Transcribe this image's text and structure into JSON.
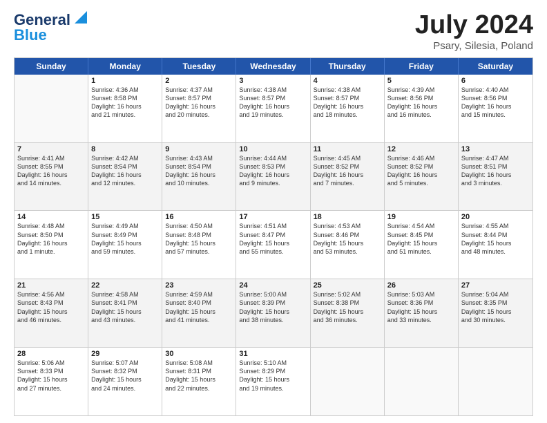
{
  "header": {
    "logo_line1": "General",
    "logo_line2": "Blue",
    "title": "July 2024",
    "subtitle": "Psary, Silesia, Poland"
  },
  "calendar": {
    "days": [
      "Sunday",
      "Monday",
      "Tuesday",
      "Wednesday",
      "Thursday",
      "Friday",
      "Saturday"
    ],
    "rows": [
      [
        {
          "num": "",
          "lines": []
        },
        {
          "num": "1",
          "lines": [
            "Sunrise: 4:36 AM",
            "Sunset: 8:58 PM",
            "Daylight: 16 hours",
            "and 21 minutes."
          ]
        },
        {
          "num": "2",
          "lines": [
            "Sunrise: 4:37 AM",
            "Sunset: 8:57 PM",
            "Daylight: 16 hours",
            "and 20 minutes."
          ]
        },
        {
          "num": "3",
          "lines": [
            "Sunrise: 4:38 AM",
            "Sunset: 8:57 PM",
            "Daylight: 16 hours",
            "and 19 minutes."
          ]
        },
        {
          "num": "4",
          "lines": [
            "Sunrise: 4:38 AM",
            "Sunset: 8:57 PM",
            "Daylight: 16 hours",
            "and 18 minutes."
          ]
        },
        {
          "num": "5",
          "lines": [
            "Sunrise: 4:39 AM",
            "Sunset: 8:56 PM",
            "Daylight: 16 hours",
            "and 16 minutes."
          ]
        },
        {
          "num": "6",
          "lines": [
            "Sunrise: 4:40 AM",
            "Sunset: 8:56 PM",
            "Daylight: 16 hours",
            "and 15 minutes."
          ]
        }
      ],
      [
        {
          "num": "7",
          "lines": [
            "Sunrise: 4:41 AM",
            "Sunset: 8:55 PM",
            "Daylight: 16 hours",
            "and 14 minutes."
          ]
        },
        {
          "num": "8",
          "lines": [
            "Sunrise: 4:42 AM",
            "Sunset: 8:54 PM",
            "Daylight: 16 hours",
            "and 12 minutes."
          ]
        },
        {
          "num": "9",
          "lines": [
            "Sunrise: 4:43 AM",
            "Sunset: 8:54 PM",
            "Daylight: 16 hours",
            "and 10 minutes."
          ]
        },
        {
          "num": "10",
          "lines": [
            "Sunrise: 4:44 AM",
            "Sunset: 8:53 PM",
            "Daylight: 16 hours",
            "and 9 minutes."
          ]
        },
        {
          "num": "11",
          "lines": [
            "Sunrise: 4:45 AM",
            "Sunset: 8:52 PM",
            "Daylight: 16 hours",
            "and 7 minutes."
          ]
        },
        {
          "num": "12",
          "lines": [
            "Sunrise: 4:46 AM",
            "Sunset: 8:52 PM",
            "Daylight: 16 hours",
            "and 5 minutes."
          ]
        },
        {
          "num": "13",
          "lines": [
            "Sunrise: 4:47 AM",
            "Sunset: 8:51 PM",
            "Daylight: 16 hours",
            "and 3 minutes."
          ]
        }
      ],
      [
        {
          "num": "14",
          "lines": [
            "Sunrise: 4:48 AM",
            "Sunset: 8:50 PM",
            "Daylight: 16 hours",
            "and 1 minute."
          ]
        },
        {
          "num": "15",
          "lines": [
            "Sunrise: 4:49 AM",
            "Sunset: 8:49 PM",
            "Daylight: 15 hours",
            "and 59 minutes."
          ]
        },
        {
          "num": "16",
          "lines": [
            "Sunrise: 4:50 AM",
            "Sunset: 8:48 PM",
            "Daylight: 15 hours",
            "and 57 minutes."
          ]
        },
        {
          "num": "17",
          "lines": [
            "Sunrise: 4:51 AM",
            "Sunset: 8:47 PM",
            "Daylight: 15 hours",
            "and 55 minutes."
          ]
        },
        {
          "num": "18",
          "lines": [
            "Sunrise: 4:53 AM",
            "Sunset: 8:46 PM",
            "Daylight: 15 hours",
            "and 53 minutes."
          ]
        },
        {
          "num": "19",
          "lines": [
            "Sunrise: 4:54 AM",
            "Sunset: 8:45 PM",
            "Daylight: 15 hours",
            "and 51 minutes."
          ]
        },
        {
          "num": "20",
          "lines": [
            "Sunrise: 4:55 AM",
            "Sunset: 8:44 PM",
            "Daylight: 15 hours",
            "and 48 minutes."
          ]
        }
      ],
      [
        {
          "num": "21",
          "lines": [
            "Sunrise: 4:56 AM",
            "Sunset: 8:43 PM",
            "Daylight: 15 hours",
            "and 46 minutes."
          ]
        },
        {
          "num": "22",
          "lines": [
            "Sunrise: 4:58 AM",
            "Sunset: 8:41 PM",
            "Daylight: 15 hours",
            "and 43 minutes."
          ]
        },
        {
          "num": "23",
          "lines": [
            "Sunrise: 4:59 AM",
            "Sunset: 8:40 PM",
            "Daylight: 15 hours",
            "and 41 minutes."
          ]
        },
        {
          "num": "24",
          "lines": [
            "Sunrise: 5:00 AM",
            "Sunset: 8:39 PM",
            "Daylight: 15 hours",
            "and 38 minutes."
          ]
        },
        {
          "num": "25",
          "lines": [
            "Sunrise: 5:02 AM",
            "Sunset: 8:38 PM",
            "Daylight: 15 hours",
            "and 36 minutes."
          ]
        },
        {
          "num": "26",
          "lines": [
            "Sunrise: 5:03 AM",
            "Sunset: 8:36 PM",
            "Daylight: 15 hours",
            "and 33 minutes."
          ]
        },
        {
          "num": "27",
          "lines": [
            "Sunrise: 5:04 AM",
            "Sunset: 8:35 PM",
            "Daylight: 15 hours",
            "and 30 minutes."
          ]
        }
      ],
      [
        {
          "num": "28",
          "lines": [
            "Sunrise: 5:06 AM",
            "Sunset: 8:33 PM",
            "Daylight: 15 hours",
            "and 27 minutes."
          ]
        },
        {
          "num": "29",
          "lines": [
            "Sunrise: 5:07 AM",
            "Sunset: 8:32 PM",
            "Daylight: 15 hours",
            "and 24 minutes."
          ]
        },
        {
          "num": "30",
          "lines": [
            "Sunrise: 5:08 AM",
            "Sunset: 8:31 PM",
            "Daylight: 15 hours",
            "and 22 minutes."
          ]
        },
        {
          "num": "31",
          "lines": [
            "Sunrise: 5:10 AM",
            "Sunset: 8:29 PM",
            "Daylight: 15 hours",
            "and 19 minutes."
          ]
        },
        {
          "num": "",
          "lines": []
        },
        {
          "num": "",
          "lines": []
        },
        {
          "num": "",
          "lines": []
        }
      ]
    ]
  }
}
